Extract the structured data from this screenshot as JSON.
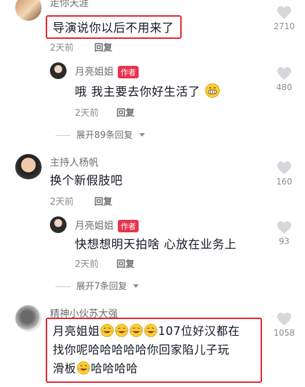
{
  "colors": {
    "accent": "#e8344e",
    "highlight_box": "#e8202a",
    "like_icon": "#d6d7db"
  },
  "comments": [
    {
      "user": "走你天涯",
      "text": "导演说你以后不用来了",
      "time": "2天前",
      "reply": "回复",
      "likes": "2710"
    },
    {
      "user": "月亮姐姐",
      "badge": "作者",
      "text": "哦 我主要去你好生活了",
      "time": "2天前",
      "reply": "回复",
      "likes": "480"
    },
    {
      "user": "主持人杨帆",
      "text": "换个新假肢吧",
      "time": "2天前",
      "reply": "回复",
      "likes": "160"
    },
    {
      "user": "月亮姐姐",
      "badge": "作者",
      "text": "快想想明天拍啥 心放在业务上",
      "time": "2天前",
      "reply": "回复",
      "likes": "93"
    },
    {
      "user": "精神小伙苏大强",
      "text_part1": "月亮姐姐",
      "text_part2": "107位好汉都在",
      "text_line2": "找你呢哈哈哈哈哈你回家陷儿子玩",
      "text_line3_a": "滑板",
      "text_line3_b": "哈哈哈哈",
      "likes": "1058"
    }
  ],
  "expand": [
    {
      "label": "展开89条回复"
    },
    {
      "label": "展开7条回复"
    }
  ],
  "emoji_name": "laughing-tears-emoji"
}
